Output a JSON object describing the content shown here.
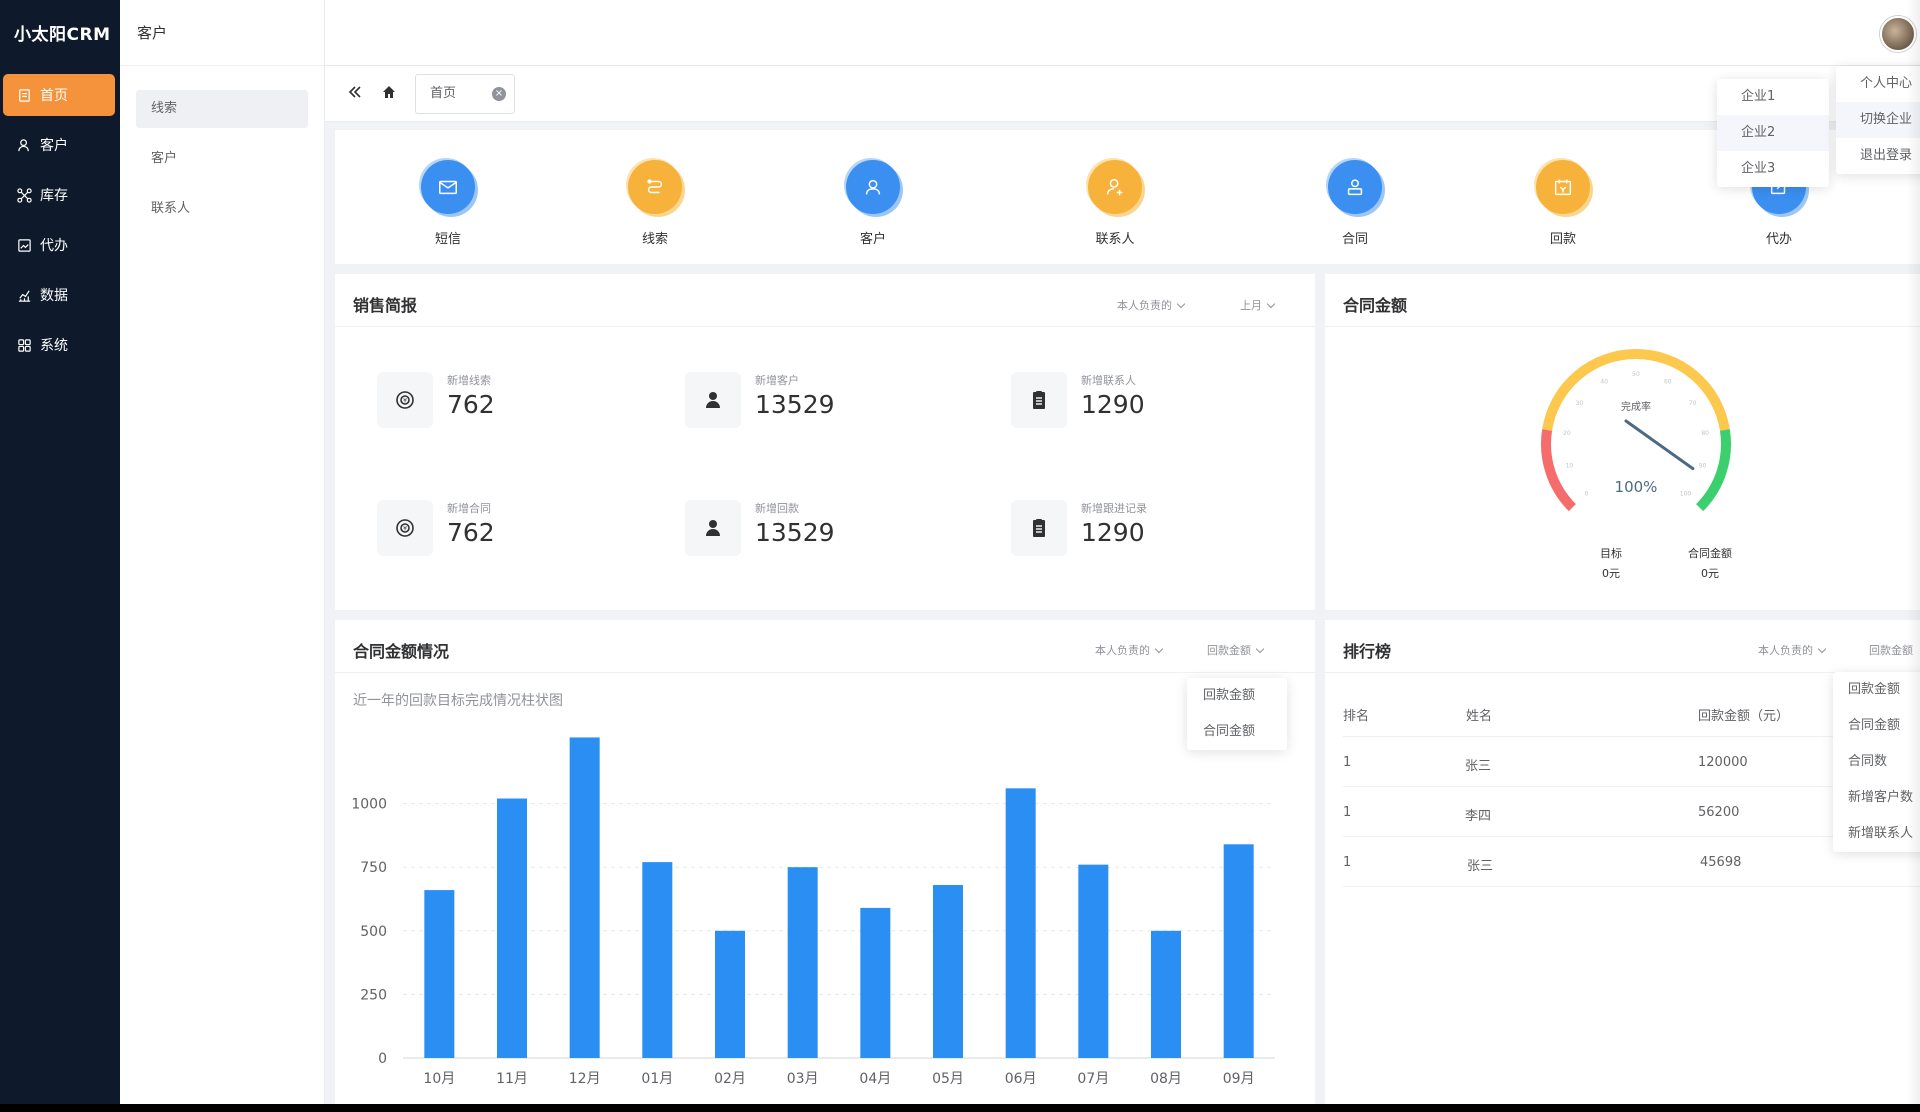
{
  "app": {
    "logo": "小太阳CRM"
  },
  "colors": {
    "sidebar": "#0e1a2b",
    "accent": "#f5933c",
    "bar": "#2a8ef2",
    "shortcut_blue": "#3a8ff0",
    "shortcut_orange": "#f7b23b",
    "gauge_red": "#f56c6c",
    "gauge_yellow": "#fcc84e",
    "gauge_green": "#3ccf6e"
  },
  "sidebar": {
    "items": [
      {
        "label": "首页",
        "icon": "document-icon"
      },
      {
        "label": "客户",
        "icon": "user-icon"
      },
      {
        "label": "库存",
        "icon": "network-icon"
      },
      {
        "label": "代办",
        "icon": "picture-icon"
      },
      {
        "label": "数据",
        "icon": "line-chart-icon"
      },
      {
        "label": "系统",
        "icon": "grid-icon"
      }
    ]
  },
  "subsidebar": {
    "title": "客户",
    "items": [
      "线索",
      "客户",
      "联系人"
    ]
  },
  "tabs": {
    "home_tab": "首页"
  },
  "shortcuts": [
    "短信",
    "线索",
    "客户",
    "联系人",
    "合同",
    "回款",
    "代办"
  ],
  "sales_report": {
    "title": "销售简报",
    "filter_owner": "本人负责的",
    "filter_period": "上月",
    "stats": [
      {
        "label": "新增线索",
        "value": "762"
      },
      {
        "label": "新增客户",
        "value": "13529"
      },
      {
        "label": "新增联系人",
        "value": "1290"
      },
      {
        "label": "新增合同",
        "value": "762"
      },
      {
        "label": "新增回款",
        "value": "13529"
      },
      {
        "label": "新增跟进记录",
        "value": "1290"
      }
    ]
  },
  "contract_gauge": {
    "title": "合同金额",
    "gauge_label": "完成率",
    "percent": 100,
    "percent_text": "100%",
    "scale_labels": [
      "0",
      "10",
      "20",
      "30",
      "40",
      "50",
      "60",
      "70",
      "80",
      "90",
      "100"
    ],
    "target_label": "目标",
    "target_value": "0元",
    "amount_label": "合同金额",
    "amount_value": "0元"
  },
  "contract_chart": {
    "title": "合同金额情况",
    "filter_owner": "本人负责的",
    "filter_type": "回款金额",
    "subtitle": "近一年的回款目标完成情况柱状图",
    "legend_options": [
      "回款金额",
      "合同金额"
    ]
  },
  "chart_data": {
    "type": "bar",
    "categories": [
      "10月",
      "11月",
      "12月",
      "01月",
      "02月",
      "03月",
      "04月",
      "05月",
      "06月",
      "07月",
      "08月",
      "09月"
    ],
    "values": [
      660,
      1020,
      1260,
      770,
      500,
      750,
      590,
      680,
      1060,
      760,
      500,
      840
    ],
    "ylim": [
      0,
      1250
    ],
    "yticks": [
      0,
      250,
      500,
      750,
      1000
    ],
    "grid": true
  },
  "ranking": {
    "title": "排行榜",
    "filter_owner": "本人负责的",
    "filter_type": "回款金额",
    "columns": [
      "排名",
      "姓名",
      "回款金额（元）"
    ],
    "rows": [
      {
        "rank": "1",
        "name": "张三",
        "amount": "120000"
      },
      {
        "rank": "1",
        "name": "李四",
        "amount": "56200"
      },
      {
        "rank": "1",
        "name": "张三",
        "amount": "45698"
      }
    ],
    "metric_options": [
      "回款金额",
      "合同金额",
      "合同数",
      "新增客户数",
      "新增联系人"
    ]
  },
  "enterprise_menu": [
    "企业1",
    "企业2",
    "企业3"
  ],
  "user_menu": [
    "个人中心",
    "切换企业",
    "退出登录"
  ]
}
